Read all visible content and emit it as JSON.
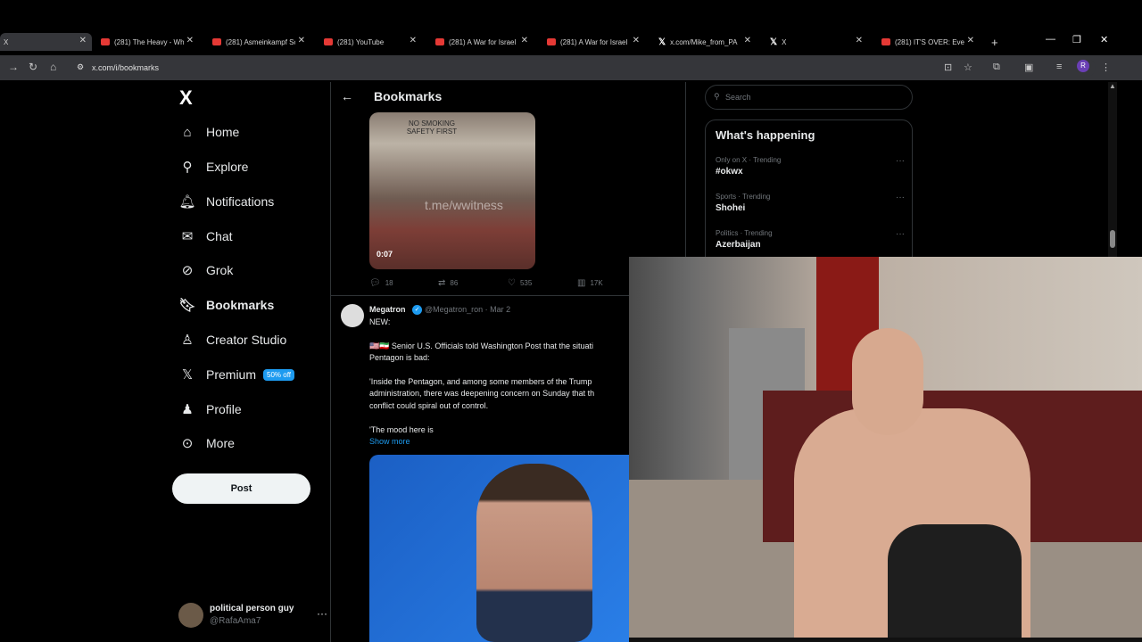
{
  "browser": {
    "tabs": [
      {
        "title": "X",
        "active": true
      },
      {
        "title": "(281) The Heavy - Wh"
      },
      {
        "title": "(281) Asmeinkampf Sc"
      },
      {
        "title": "(281) YouTube"
      },
      {
        "title": "(281) A War for Israel"
      },
      {
        "title": "(281) A War for Israel"
      },
      {
        "title": "x.com/Mike_from_PA"
      },
      {
        "title": "X"
      },
      {
        "title": "(281) IT'S OVER: Even"
      }
    ],
    "new_tab": "+",
    "url": "x.com/i/bookmarks"
  },
  "sidebar": {
    "logo": "X",
    "items": [
      {
        "label": "Home",
        "icon": "home-icon"
      },
      {
        "label": "Explore",
        "icon": "search-icon"
      },
      {
        "label": "Notifications",
        "icon": "bell-icon"
      },
      {
        "label": "Chat",
        "icon": "mail-icon"
      },
      {
        "label": "Grok",
        "icon": "grok-icon"
      },
      {
        "label": "Bookmarks",
        "icon": "bookmark-icon"
      },
      {
        "label": "Creator Studio",
        "icon": "creator-studio-icon"
      },
      {
        "label": "Premium",
        "icon": "x-icon",
        "badge": "50% off"
      },
      {
        "label": "Profile",
        "icon": "person-icon"
      },
      {
        "label": "More",
        "icon": "more-icon"
      }
    ],
    "post_label": "Post",
    "account": {
      "name": "political person guy",
      "handle": "@RafaAma7"
    }
  },
  "feed": {
    "title": "Bookmarks",
    "tweet1": {
      "video_text": "NO SMOKING SAFETY FIRST",
      "watermark": "t.me/wwitness",
      "duration": "0:07",
      "replies": "18",
      "retweets": "86",
      "likes": "535",
      "views": "17K"
    },
    "tweet2": {
      "name": "Megatron",
      "handle": "@Megatron_ron",
      "date": "Mar 2",
      "meta": "@Megatron_ron · Mar 2",
      "lines": [
        "NEW:",
        "🇺🇸🇮🇷 Senior U.S. Officials told Washington Post that the situati",
        "Pentagon is bad:",
        "'Inside the Pentagon, and among some members of the Trump",
        "administration, there was deepening concern on Sunday that th",
        "conflict could spiral out of control.",
        "'The mood here is"
      ],
      "show_more": "Show more"
    }
  },
  "right": {
    "search_placeholder": "Search",
    "trends_title": "What's happening",
    "trends": [
      {
        "context": "Only on X · Trending",
        "name": "#okwx"
      },
      {
        "context": "Sports · Trending",
        "name": "Shohei"
      },
      {
        "context": "Politics · Trending",
        "name": "Azerbaijan"
      }
    ]
  }
}
